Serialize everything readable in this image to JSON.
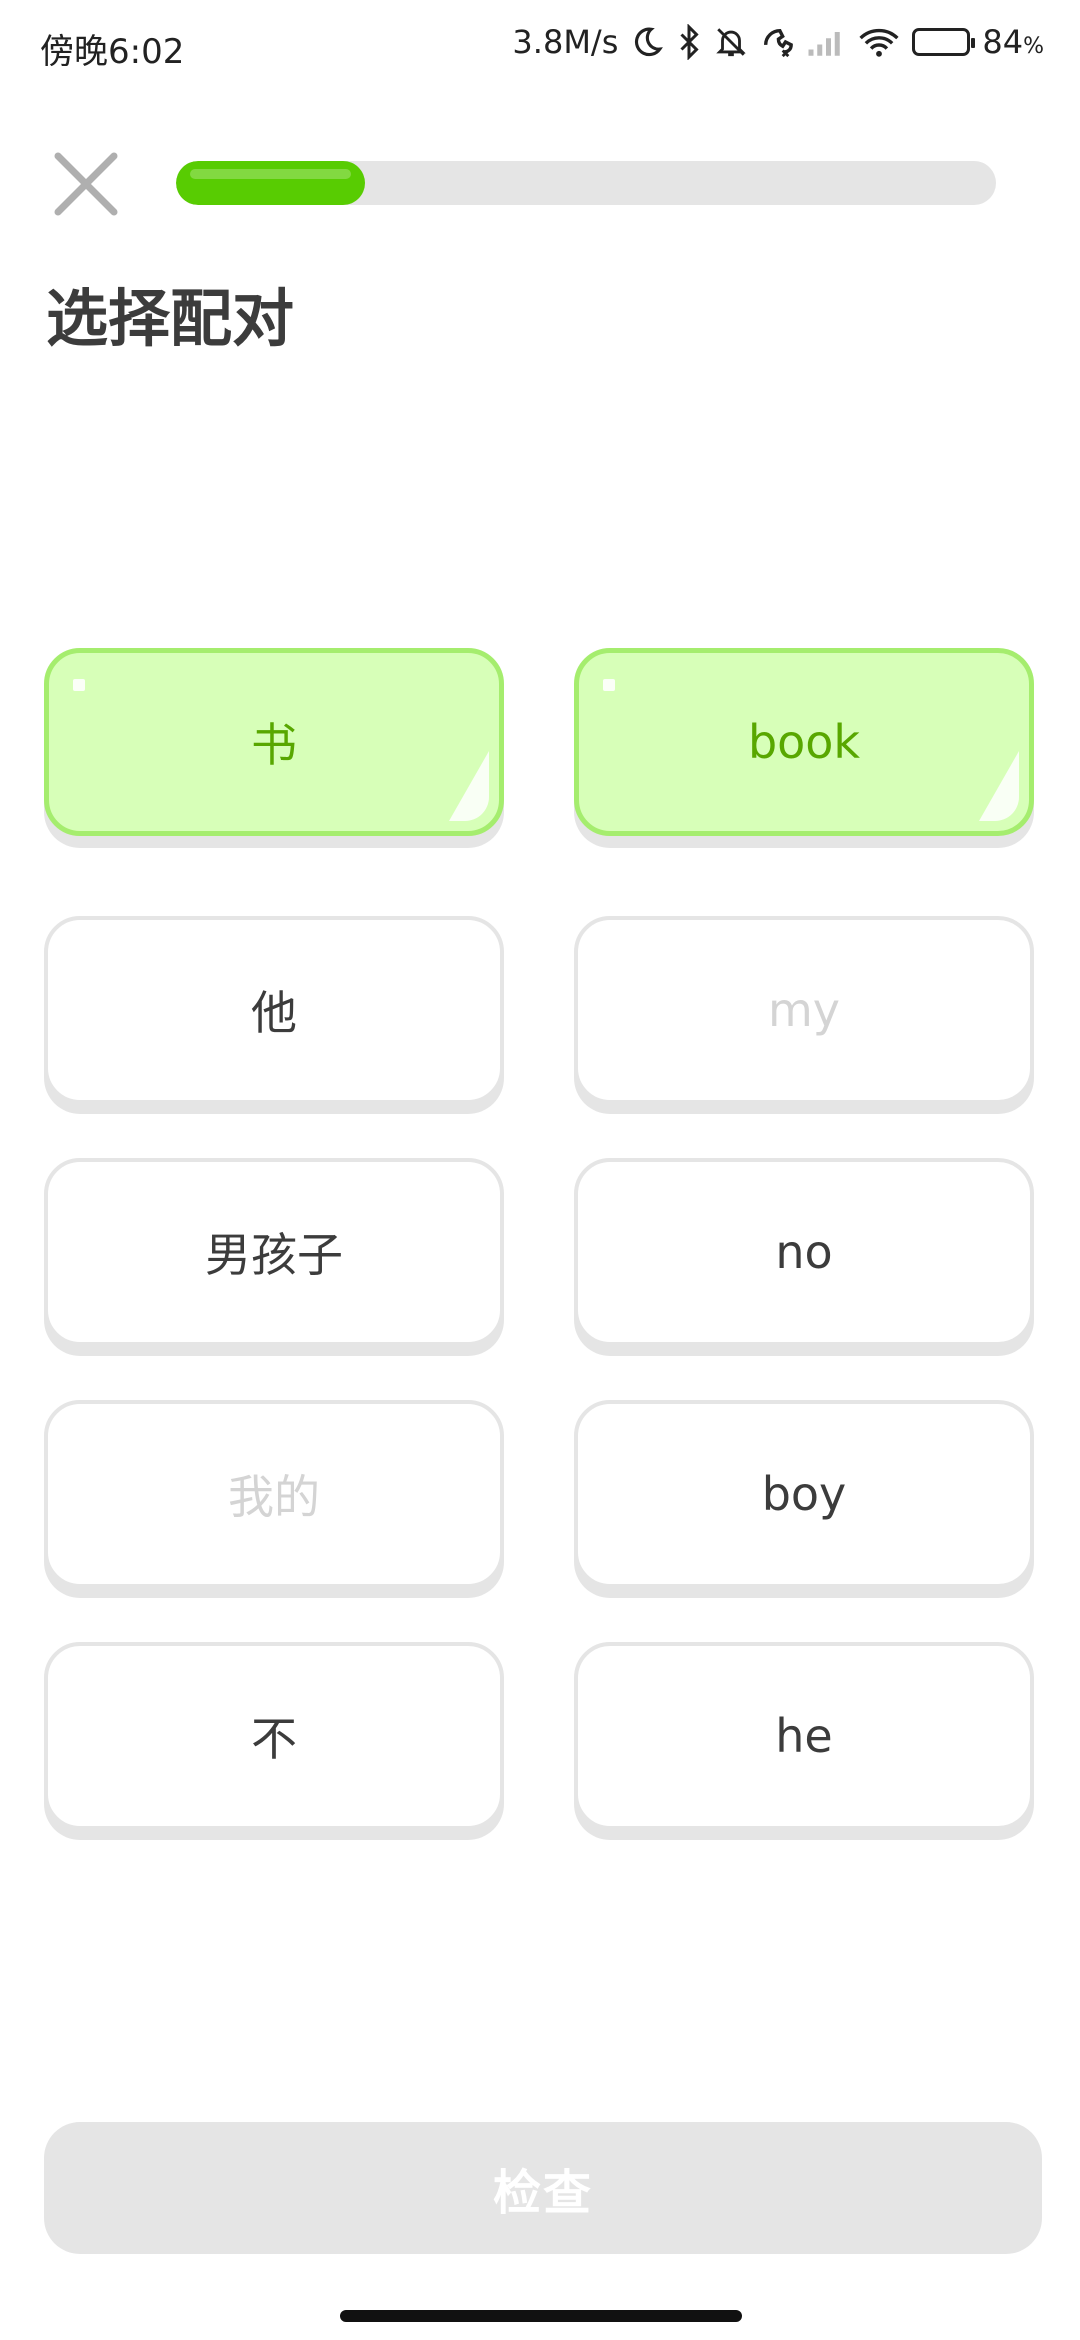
{
  "status_bar": {
    "time": "傍晚6:02",
    "net_speed": "3.8M/s",
    "battery_percent": "84",
    "battery_unit": "%",
    "battery_level": 0.84,
    "icons": [
      "moon-icon",
      "bluetooth-icon",
      "mute-icon",
      "call-icon",
      "signal-icon",
      "wifi-icon",
      "battery-icon"
    ]
  },
  "header": {
    "close_icon": "close-icon",
    "progress": 0.23
  },
  "title": "选择配对",
  "tiles": {
    "left": [
      {
        "label": "书",
        "state": "selected"
      },
      {
        "label": "他",
        "state": "normal"
      },
      {
        "label": "男孩子",
        "state": "normal"
      },
      {
        "label": "我的",
        "state": "disabled"
      },
      {
        "label": "不",
        "state": "normal"
      }
    ],
    "right": [
      {
        "label": "book",
        "state": "selected"
      },
      {
        "label": "my",
        "state": "disabled"
      },
      {
        "label": "no",
        "state": "normal"
      },
      {
        "label": "boy",
        "state": "normal"
      },
      {
        "label": "he",
        "state": "normal"
      }
    ]
  },
  "check_button": {
    "label": "检查",
    "state": "disabled"
  },
  "colors": {
    "accent_green": "#58cc02",
    "selected_bg": "#d7ffb8",
    "selected_border": "#a5ed6e",
    "selected_text": "#58a700",
    "neutral_border": "#e5e5e5",
    "disabled_text": "#d4d4d4"
  }
}
